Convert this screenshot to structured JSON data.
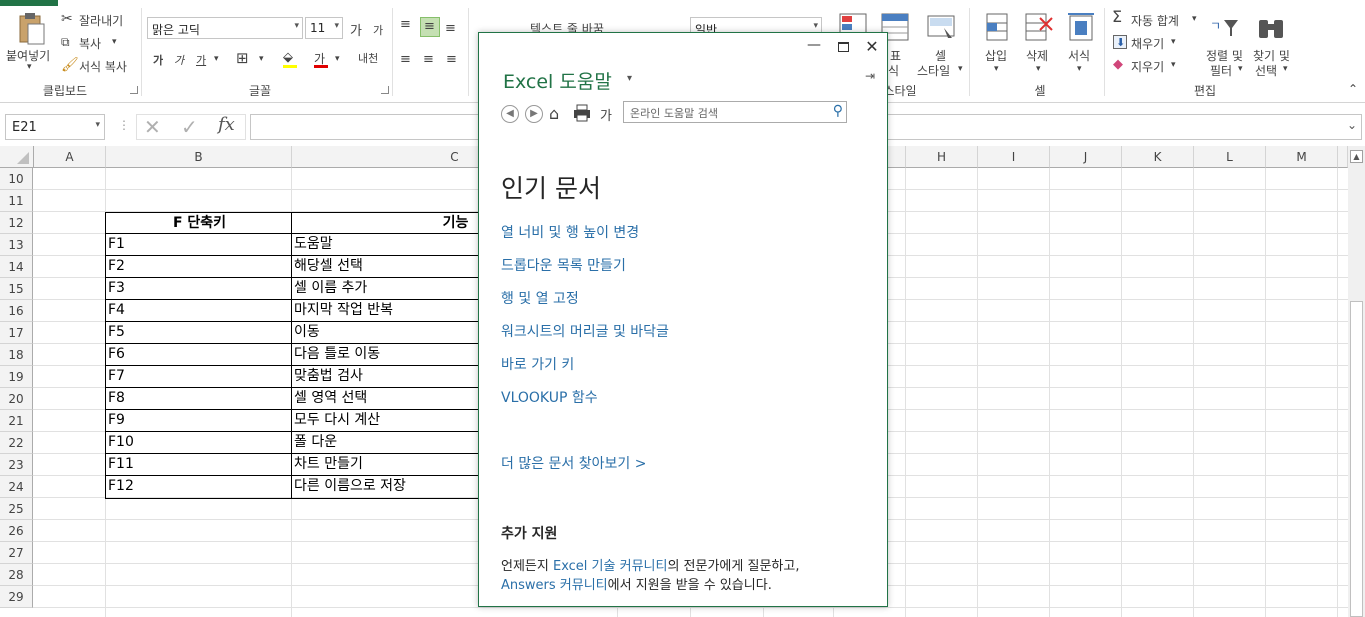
{
  "ribbon": {
    "clipboard": {
      "paste": "붙여넣기",
      "cut": "잘라내기",
      "copy": "복사",
      "format_painter": "서식 복사",
      "group": "클립보드"
    },
    "font": {
      "name": "맑은 고딕",
      "size": "11",
      "increase": "가",
      "decrease": "가",
      "bold": "가",
      "italic": "가",
      "underline": "가",
      "font_color": "가",
      "phonetic": "내천",
      "group": "글꼴"
    },
    "alignment": {
      "wrap_text": "텍스트 줄 바꿈"
    },
    "number": {
      "format": "일반"
    },
    "styles": {
      "cond_partial": "표",
      "format_table_partial": "식",
      "cell_styles_1": "셀",
      "cell_styles_2": "스타일",
      "group": "스타일"
    },
    "cells": {
      "insert": "삽입",
      "delete": "삭제",
      "format": "서식",
      "group": "셀"
    },
    "editing": {
      "autosum": "자동 합계",
      "fill": "채우기",
      "clear": "지우기",
      "sort_1": "정렬 및",
      "sort_2": "필터",
      "find_1": "찾기 및",
      "find_2": "선택",
      "group": "편집"
    }
  },
  "formula_bar": {
    "name_box": "E21",
    "fx": "fx",
    "content": ""
  },
  "columns": [
    "A",
    "B",
    "C",
    "H",
    "I",
    "J",
    "K",
    "L",
    "M"
  ],
  "rows": [
    "10",
    "11",
    "12",
    "13",
    "14",
    "15",
    "16",
    "17",
    "18",
    "19",
    "20",
    "21",
    "22",
    "23",
    "24",
    "25",
    "26",
    "27",
    "28",
    "29"
  ],
  "table": {
    "headers": [
      "F 단축키",
      "기능"
    ],
    "rows": [
      [
        "F1",
        "도움말"
      ],
      [
        "F2",
        "해당셀 선택"
      ],
      [
        "F3",
        "셀 이름 추가"
      ],
      [
        "F4",
        "마지막 작업 반복"
      ],
      [
        "F5",
        "이동"
      ],
      [
        "F6",
        "다음 틀로 이동"
      ],
      [
        "F7",
        "맞춤법 검사"
      ],
      [
        "F8",
        "셀 영역 선택"
      ],
      [
        "F9",
        "모두 다시 계산"
      ],
      [
        "F10",
        "폴 다운"
      ],
      [
        "F11",
        "차트 만들기"
      ],
      [
        "F12",
        "다른 이름으로 저장"
      ]
    ]
  },
  "help": {
    "title": "Excel 도움말",
    "search_placeholder": "온라인 도움말 검색",
    "heading": "인기 문서",
    "links": [
      "열 너비 및 행 높이 변경",
      "드롭다운 목록 만들기",
      "행 및 열 고정",
      "워크시트의 머리글 및 바닥글",
      "바로 가기 키",
      "VLOOKUP 함수"
    ],
    "more": "더 많은 문서 찾아보기 >",
    "support_heading": "추가 지원",
    "support_pre": "언제든지 ",
    "support_link1": "Excel 기술 커뮤니티",
    "support_mid": "의 전문가에게 질문하고,",
    "support_link2": "Answers 커뮤니티",
    "support_post": "에서 지원을 받을 수 있습니다."
  },
  "colors": {
    "accent": "#217346",
    "link": "#2a6fa8"
  }
}
